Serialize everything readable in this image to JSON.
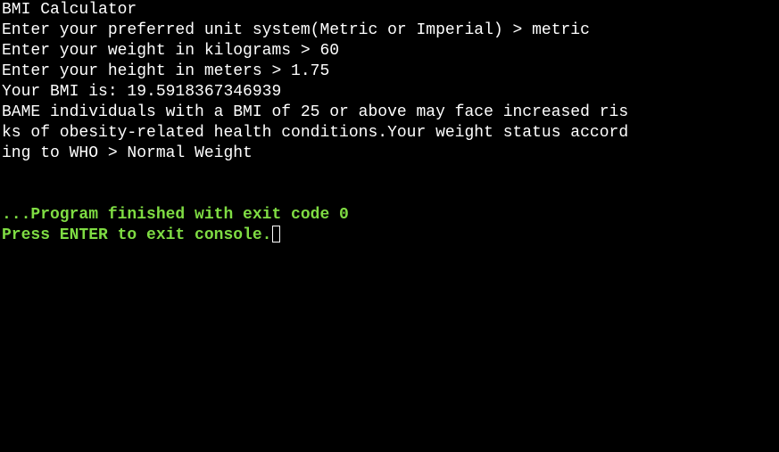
{
  "console": {
    "lines": [
      "BMI Calculator",
      "Enter your preferred unit system(Metric or Imperial) > metric",
      "Enter your weight in kilograms > 60",
      "Enter your height in meters > 1.75",
      "Your BMI is: 19.5918367346939",
      "BAME individuals with a BMI of 25 or above may face increased ris",
      "ks of obesity-related health conditions.Your weight status accord",
      "ing to WHO > Normal Weight"
    ],
    "finished_message": "...Program finished with exit code 0",
    "exit_prompt": "Press ENTER to exit console."
  },
  "colors": {
    "background": "#000000",
    "output_text": "#ffffff",
    "status_text": "#7fdc43"
  }
}
